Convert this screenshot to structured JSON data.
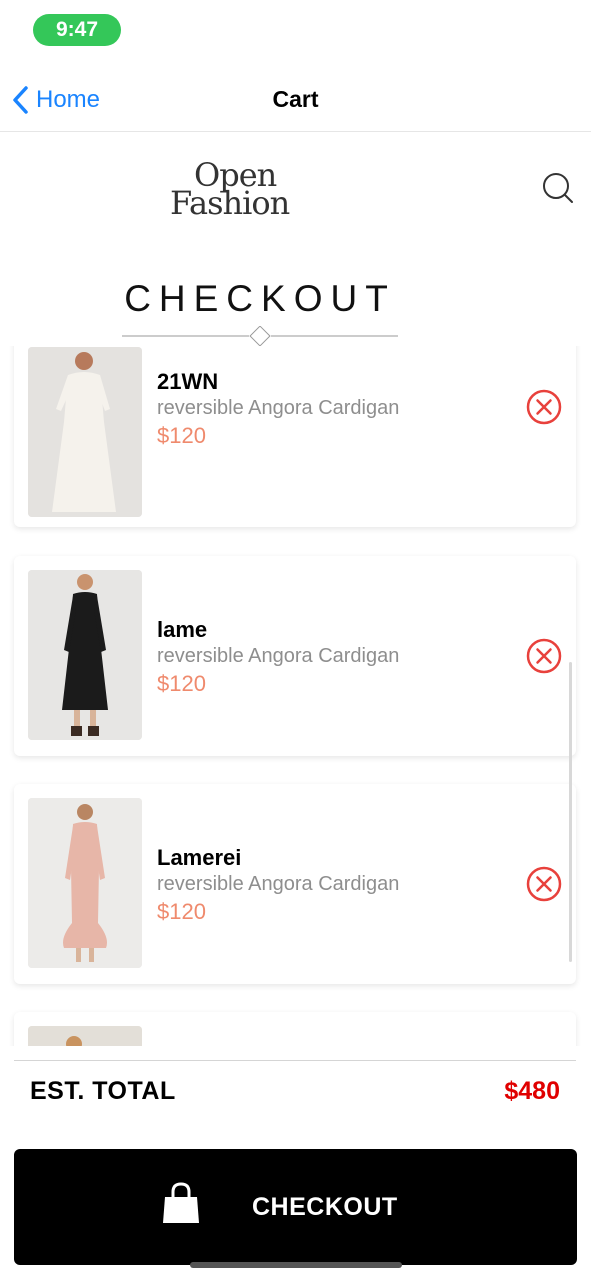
{
  "status_bar": {
    "time": "9:47"
  },
  "nav": {
    "back_label": "Home",
    "title": "Cart"
  },
  "brand": {
    "line1": "Open",
    "line2": "Fashion"
  },
  "search": {
    "icon": "search-icon"
  },
  "section": {
    "title": "CHECKOUT"
  },
  "items": [
    {
      "brand": "21WN",
      "description": "reversible Angora Cardigan",
      "price": "$120",
      "image": "white-dress"
    },
    {
      "brand": "lame",
      "description": "reversible Angora Cardigan",
      "price": "$120",
      "image": "black-dress"
    },
    {
      "brand": "Lamerei",
      "description": "reversible Angora Cardigan",
      "price": "$120",
      "image": "pink-dress"
    }
  ],
  "summary": {
    "label": "EST. TOTAL",
    "value": "$480"
  },
  "checkout_button": {
    "label": "CHECKOUT",
    "icon": "shopping-bag-icon"
  },
  "colors": {
    "accent": "#1a84ff",
    "price": "#ef8a6d",
    "total": "#e00000",
    "remove": "#e8413c",
    "status": "#34c759"
  }
}
